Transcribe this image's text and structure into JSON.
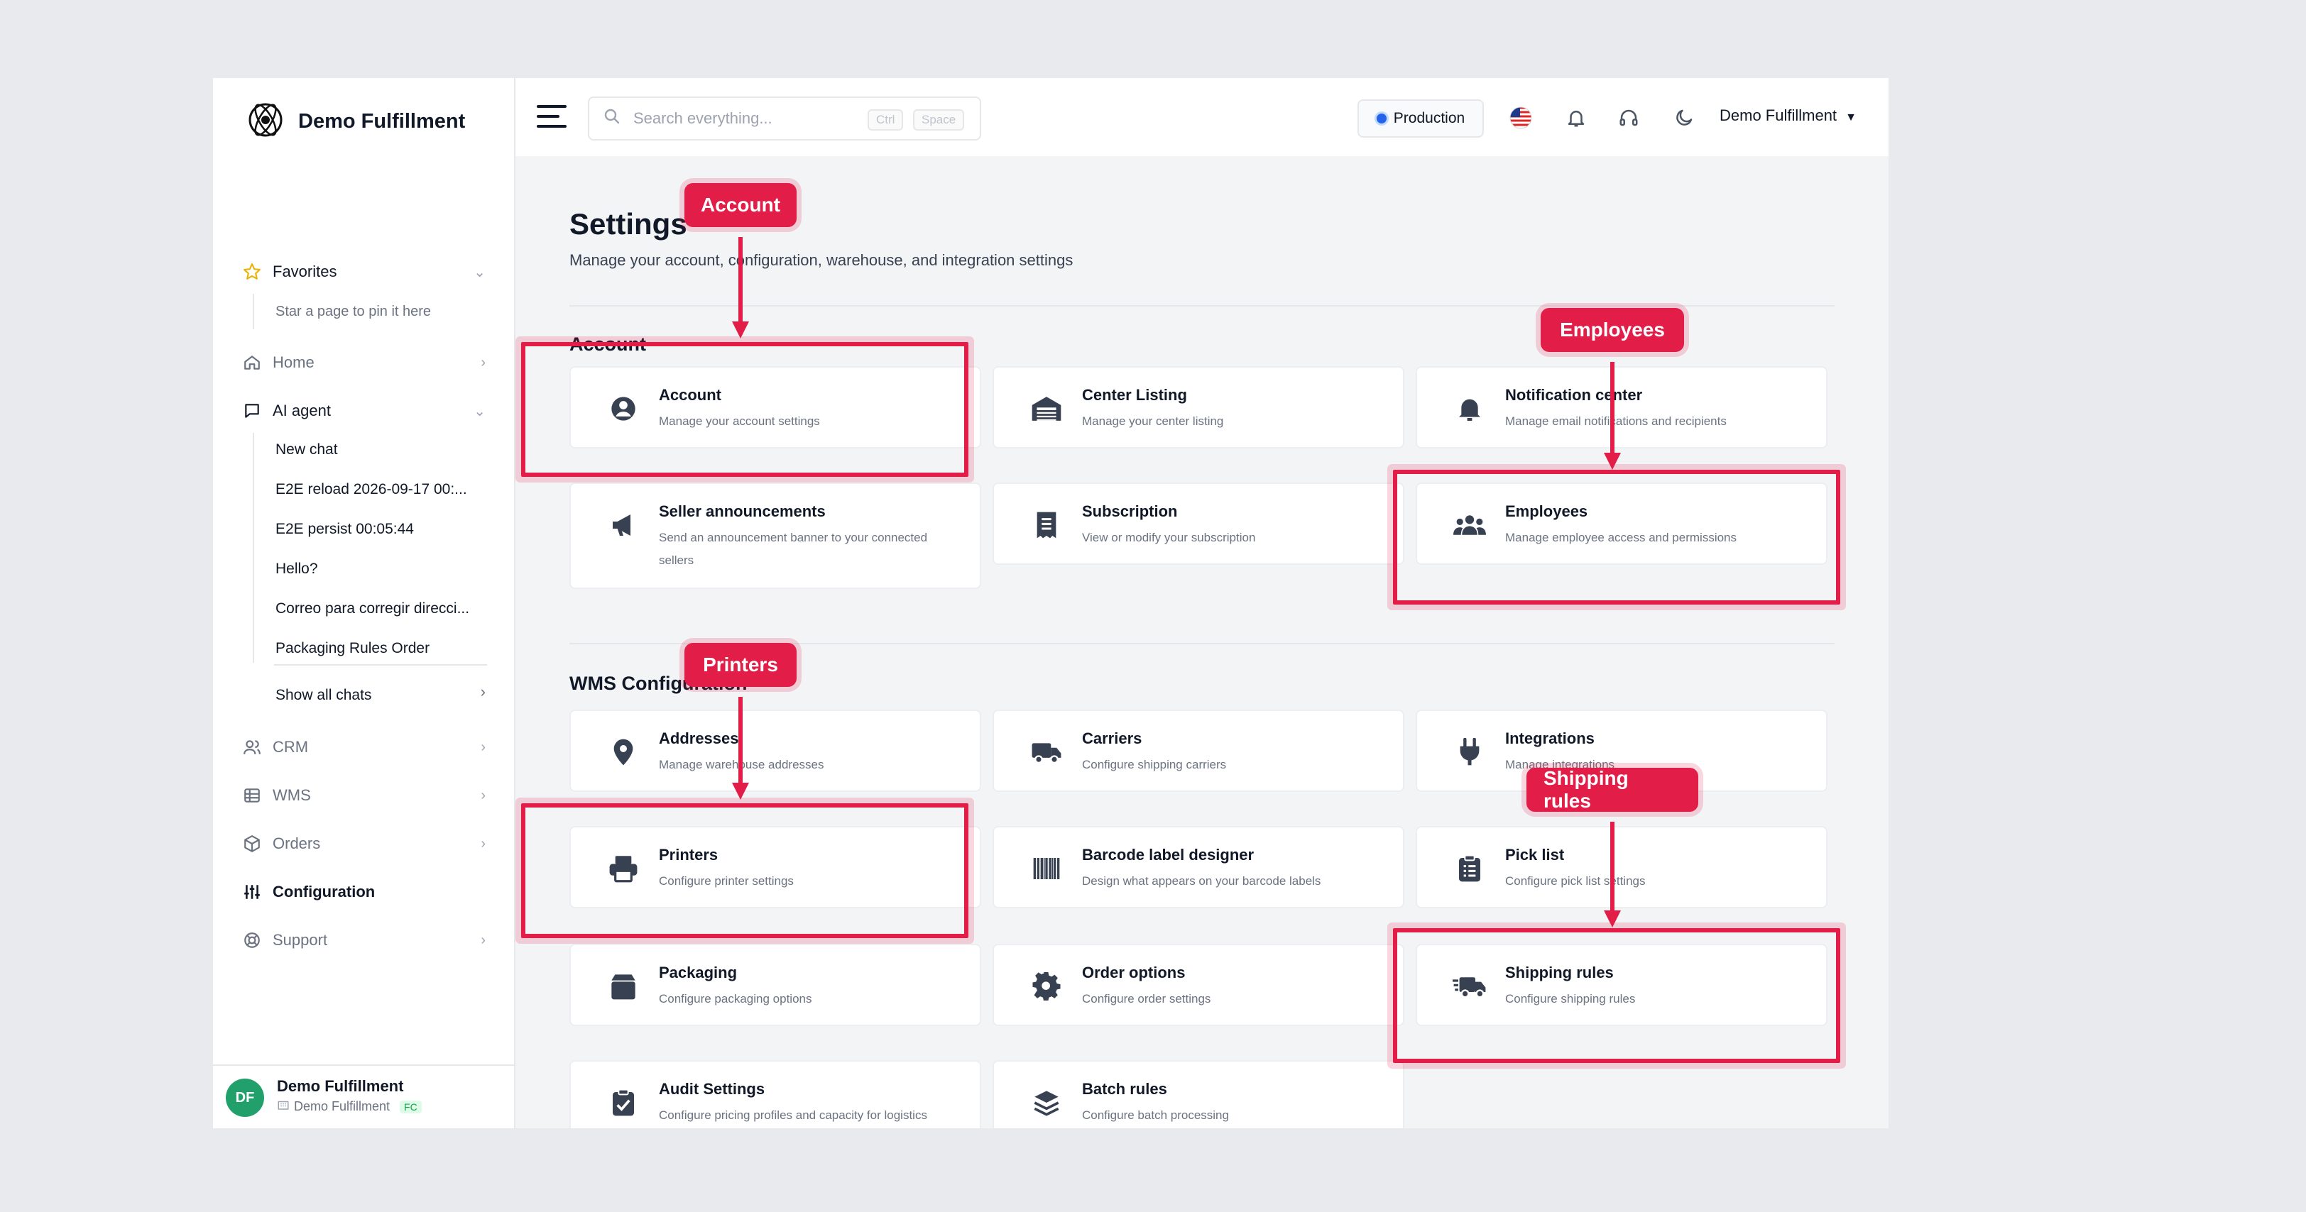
{
  "brand": {
    "name": "Demo Fulfillment",
    "logo_icon": "atom-globe-logo"
  },
  "sidebar": {
    "favorites": {
      "label": "Favorites",
      "hint": "Star a page to pin it here"
    },
    "home": "Home",
    "ai_agent": {
      "label": "AI agent",
      "chats": [
        "New chat",
        "E2E reload 2026-09-17 00:...",
        "E2E persist 00:05:44",
        "Hello?",
        "Correo para corregir direcci...",
        "Packaging Rules Order"
      ],
      "show_all": "Show all chats"
    },
    "crm": "CRM",
    "wms": "WMS",
    "orders": "Orders",
    "configuration": "Configuration",
    "support": "Support",
    "footer": {
      "initials": "DF",
      "name": "Demo Fulfillment",
      "org": "Demo Fulfillment",
      "badge": "FC"
    }
  },
  "topbar": {
    "search_placeholder": "Search everything...",
    "kbd_ctrl": "Ctrl",
    "kbd_space": "Space",
    "environment": "Production",
    "user": "Demo Fulfillment"
  },
  "page": {
    "title": "Settings",
    "description": "Manage your account, configuration, warehouse, and integration settings"
  },
  "sections": {
    "account": {
      "title": "Account",
      "cards": [
        {
          "title": "Account",
          "desc": "Manage your account settings",
          "icon": "user-circle-icon"
        },
        {
          "title": "Center Listing",
          "desc": "Manage your center listing",
          "icon": "warehouse-icon"
        },
        {
          "title": "Notification center",
          "desc": "Manage email notifications and recipients",
          "icon": "bell-icon"
        },
        {
          "title": "Seller announcements",
          "desc": "Send an announcement banner to your connected sellers",
          "icon": "megaphone-icon"
        },
        {
          "title": "Subscription",
          "desc": "View or modify your subscription",
          "icon": "receipt-icon"
        },
        {
          "title": "Employees",
          "desc": "Manage employee access and permissions",
          "icon": "users-icon"
        }
      ]
    },
    "wms": {
      "title": "WMS Configuration",
      "cards": [
        {
          "title": "Addresses",
          "desc": "Manage warehouse addresses",
          "icon": "location-pin-icon"
        },
        {
          "title": "Carriers",
          "desc": "Configure shipping carriers",
          "icon": "truck-icon"
        },
        {
          "title": "Integrations",
          "desc": "Manage integrations",
          "icon": "plug-icon"
        },
        {
          "title": "Printers",
          "desc": "Configure printer settings",
          "icon": "printer-icon"
        },
        {
          "title": "Barcode label designer",
          "desc": "Design what appears on your barcode labels",
          "icon": "barcode-icon"
        },
        {
          "title": "Pick list",
          "desc": "Configure pick list settings",
          "icon": "clipboard-list-icon"
        },
        {
          "title": "Packaging",
          "desc": "Configure packaging options",
          "icon": "box-icon"
        },
        {
          "title": "Order options",
          "desc": "Configure order settings",
          "icon": "gear-icon"
        },
        {
          "title": "Shipping rules",
          "desc": "Configure shipping rules",
          "icon": "fast-truck-icon"
        },
        {
          "title": "Audit Settings",
          "desc": "Configure pricing profiles and capacity for logistics",
          "icon": "clipboard-check-icon"
        },
        {
          "title": "Batch rules",
          "desc": "Configure batch processing",
          "icon": "layers-icon"
        }
      ]
    }
  },
  "annotations": {
    "account": "Account",
    "employees": "Employees",
    "printers": "Printers",
    "shipping_rules": "Shipping rules",
    "color": "#e11d48"
  }
}
